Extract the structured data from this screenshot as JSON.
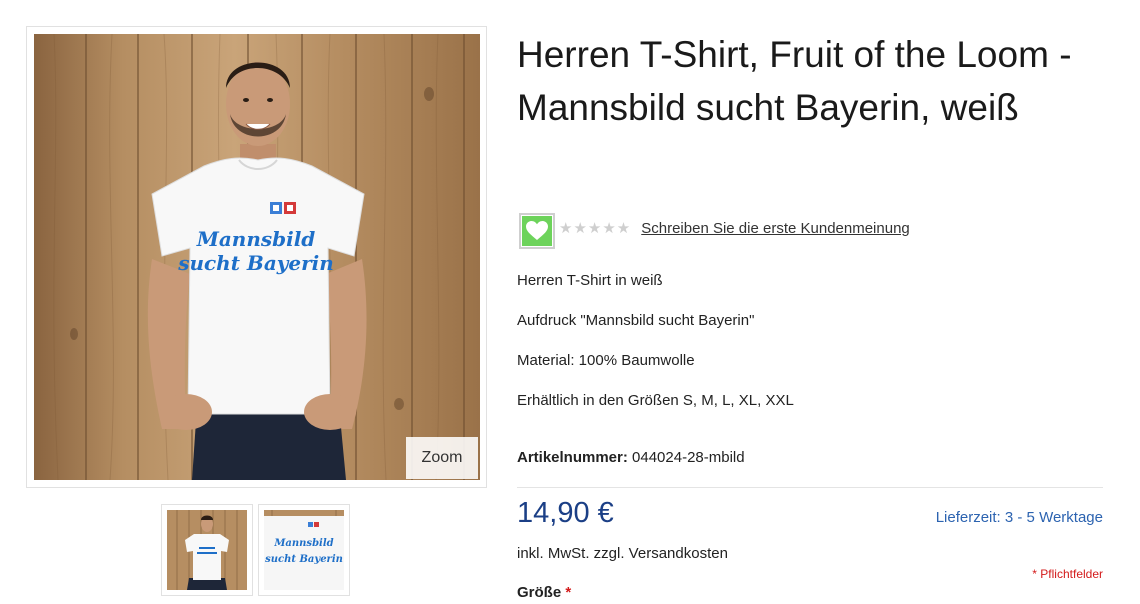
{
  "gallery": {
    "zoom_label": "Zoom",
    "main_image_alt": "T-Shirt Mannsbild sucht Bayerin",
    "shirt_print_line1": "Mannsbild",
    "shirt_print_line2": "sucht Bayerin",
    "thumbnails": [
      {
        "icon": "product-photo-model"
      },
      {
        "icon": "product-photo-print-closeup"
      }
    ]
  },
  "product": {
    "title": "Herren T-Shirt, Fruit of the Loom - Mannsbild sucht Bayerin, weiß",
    "rating": {
      "stars_display": "★★★★★",
      "stars_value": 0,
      "review_link": "Schreiben Sie die erste Kundenmeinung"
    },
    "description": [
      "Herren T-Shirt in weiß",
      "Aufdruck \"Mannsbild sucht Bayerin\"",
      "Material: 100% Baumwolle",
      "Erhältlich in den Größen S, M, L, XL, XXL"
    ],
    "sku_label": "Artikelnummer:",
    "sku_value": "044024-28-mbild",
    "price": "14,90 €",
    "delivery": "Lieferzeit: 3 - 5 Werktage",
    "tax_note": "inkl. MwSt. zzgl. Versandkosten",
    "required_note": "* Pflichtfelder",
    "size_label": "Größe",
    "required_marker": "*"
  },
  "colors": {
    "price": "#1b3f86",
    "delivery_link": "#2c63b0",
    "required": "#d31a1a",
    "wishlist_green": "#6dd35b",
    "print_blue": "#1e6fc8"
  }
}
